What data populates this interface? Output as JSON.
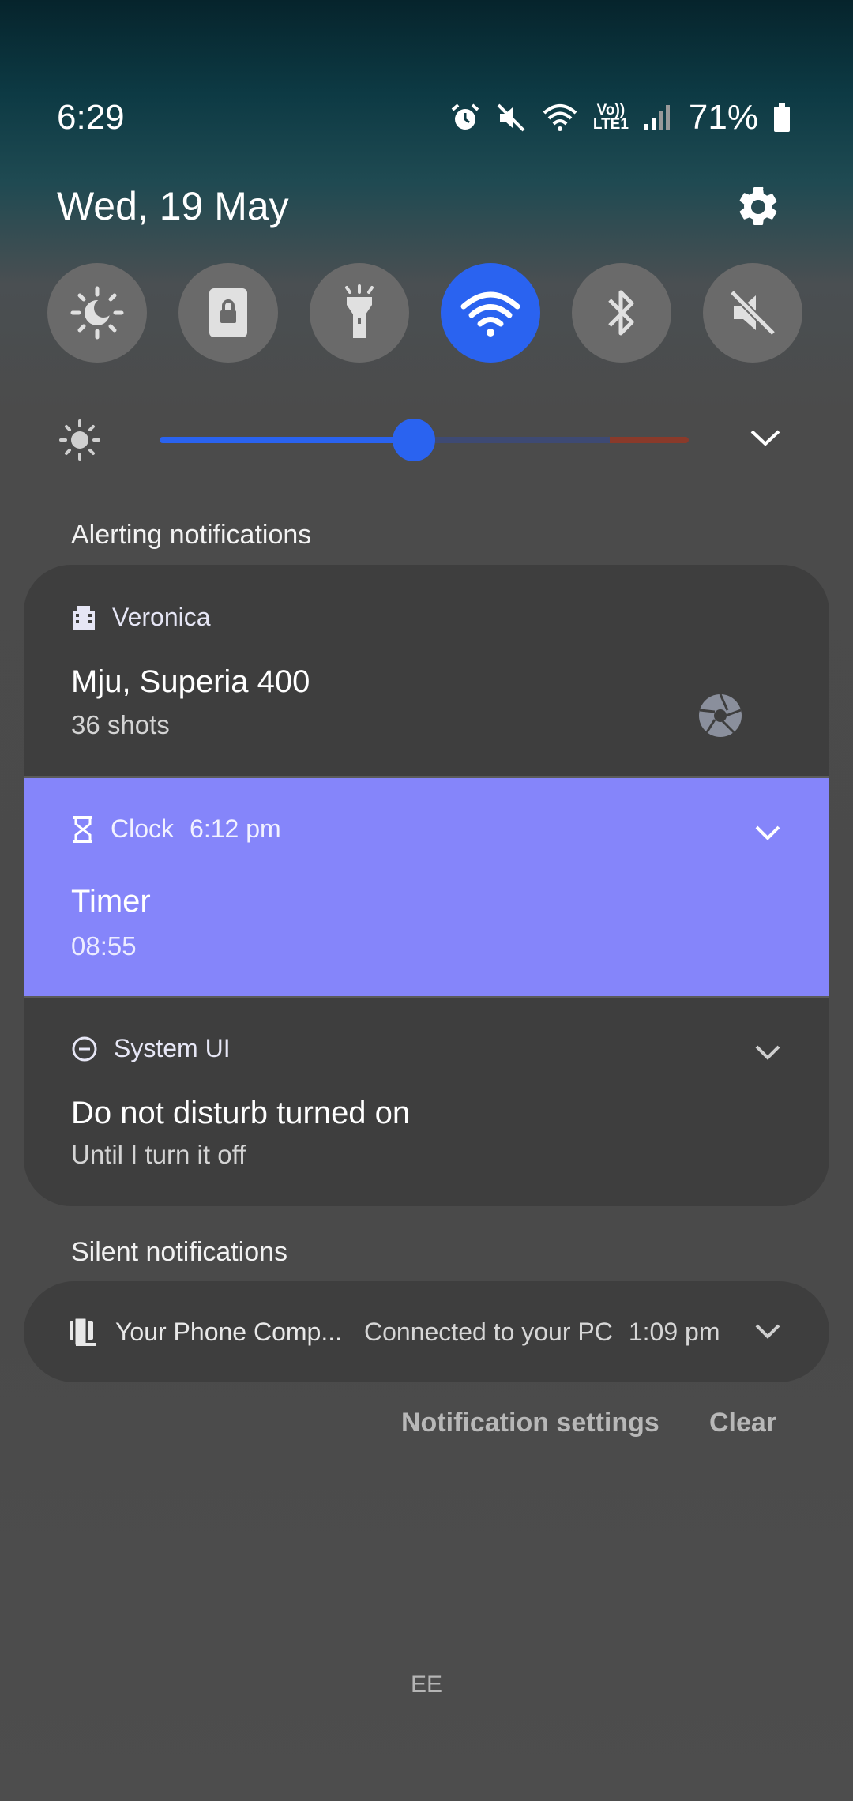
{
  "status_bar": {
    "time": "6:29",
    "battery": "71%",
    "network_label_top": "Vo))",
    "network_label_bottom": "LTE1",
    "icons": [
      "alarm-icon",
      "mute-icon",
      "wifi-icon",
      "volte-icon",
      "signal-icon",
      "battery-icon"
    ]
  },
  "header": {
    "date": "Wed, 19 May"
  },
  "quick_tiles": [
    {
      "name": "night-mode",
      "active": false
    },
    {
      "name": "screen-lock",
      "active": false
    },
    {
      "name": "flashlight",
      "active": false
    },
    {
      "name": "wifi",
      "active": true
    },
    {
      "name": "bluetooth",
      "active": false
    },
    {
      "name": "sound-mute",
      "active": false
    }
  ],
  "brightness": {
    "level": 0.48
  },
  "sections": {
    "alerting": "Alerting notifications",
    "silent": "Silent notifications"
  },
  "notifications": [
    {
      "app": "Veronica",
      "time": "",
      "title": "Mju, Superia 400",
      "text": "36 shots",
      "icon": "film-icon"
    },
    {
      "app": "Clock",
      "time": "6:12 pm",
      "title": "Timer",
      "text": "08:55",
      "icon": "hourglass-icon"
    },
    {
      "app": "System UI",
      "time": "",
      "title": "Do not disturb turned on",
      "text": "Until I turn it off",
      "icon": "dnd-icon"
    }
  ],
  "silent_notification": {
    "app": "Your Phone Comp...",
    "text": "Connected to your PC",
    "time": "1:09 pm"
  },
  "actions": {
    "settings": "Notification settings",
    "clear": "Clear"
  },
  "carrier": "EE",
  "colors": {
    "accent": "#2a63f0",
    "timer_card": "#8585fa",
    "card": "#3e3e3e"
  }
}
